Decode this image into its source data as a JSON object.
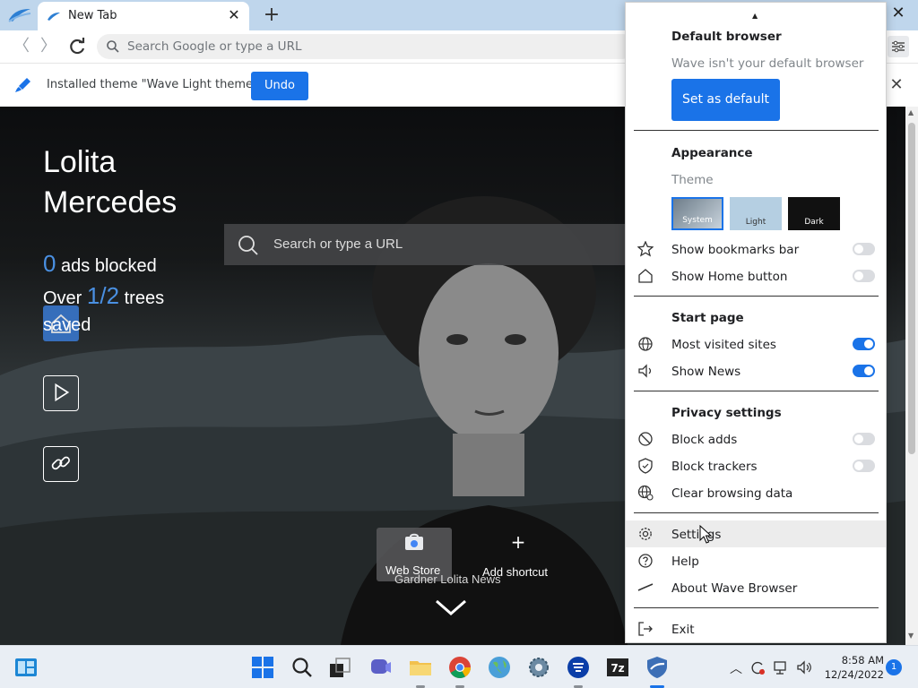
{
  "browser": {
    "tab_title": "New Tab",
    "omnibox_placeholder": "Search Google or type a URL"
  },
  "infobar": {
    "message": "Installed theme \"Wave Light theme\"",
    "undo_label": "Undo"
  },
  "newtab": {
    "user_name_first": "Lolita",
    "user_name_last": "Mercedes",
    "ads_blocked_count": "0",
    "ads_blocked_label": "ads blocked",
    "trees_prefix": "Over",
    "trees_count": "1/2",
    "trees_label": "trees",
    "trees_suffix": "saved",
    "search_placeholder": "Search or type a URL",
    "shortcuts": [
      {
        "label": "Web Store"
      },
      {
        "label": "Add shortcut"
      }
    ],
    "news_label": "Gardner Lolita News"
  },
  "menu": {
    "default_browser": {
      "heading": "Default browser",
      "status": "Wave isn't your default browser",
      "button": "Set as default"
    },
    "appearance": {
      "heading": "Appearance",
      "theme_label": "Theme",
      "themes": [
        {
          "label": "System",
          "selected": true
        },
        {
          "label": "Light",
          "selected": false
        },
        {
          "label": "Dark",
          "selected": false
        }
      ],
      "show_bookmarks_bar": {
        "label": "Show bookmarks bar",
        "on": false
      },
      "show_home_button": {
        "label": "Show Home button",
        "on": false
      }
    },
    "start_page": {
      "heading": "Start page",
      "most_visited": {
        "label": "Most visited sites",
        "on": true
      },
      "show_news": {
        "label": "Show News",
        "on": true
      }
    },
    "privacy": {
      "heading": "Privacy settings",
      "block_ads": {
        "label": "Block adds",
        "on": false
      },
      "block_trackers": {
        "label": "Block trackers",
        "on": false
      },
      "clear_data": {
        "label": "Clear browsing data"
      }
    },
    "settings_label": "Settings",
    "help_label": "Help",
    "about_label": "About Wave Browser",
    "exit_label": "Exit"
  },
  "taskbar": {
    "time": "8:58 AM",
    "date": "12/24/2022",
    "notification_count": "1"
  },
  "colors": {
    "accent": "#1a73e8",
    "tabstrip": "#bfd6ec"
  }
}
